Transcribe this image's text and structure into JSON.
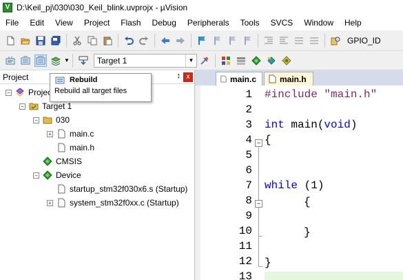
{
  "window": {
    "title": "D:\\Keil_pj\\030\\030_Keil_blink.uvprojx - µVision"
  },
  "menu": [
    "File",
    "Edit",
    "View",
    "Project",
    "Flash",
    "Debug",
    "Peripherals",
    "Tools",
    "SVCS",
    "Window",
    "Help"
  ],
  "toolbar": {
    "right_label": "GPIO_ID",
    "target_select": "Target 1"
  },
  "project_pane": {
    "title": "Project",
    "pin": "↕",
    "close": "x",
    "tree": {
      "root": "Project",
      "target": "Target 1",
      "group_030": "030",
      "file_main_c": "main.c",
      "file_main_h": "main.h",
      "cmsis": "CMSIS",
      "device": "Device",
      "startup": "startup_stm32f030x6.s (Startup)",
      "system": "system_stm32f0xx.c (Startup)"
    }
  },
  "tooltip": {
    "title": "Rebuild",
    "description": "Rebuild all target files"
  },
  "editor": {
    "tabs": [
      {
        "label": "main.c",
        "active": true
      },
      {
        "label": "main.h",
        "active": false
      }
    ],
    "line_numbers": [
      "1",
      "2",
      "3",
      "4",
      "5",
      "6",
      "7",
      "8",
      "9",
      "10",
      "11",
      "12",
      "13"
    ],
    "code": {
      "l1_directive": "#include",
      "l1_string": "\"main.h\"",
      "l3_keyword": "int",
      "l3_name": " main(",
      "l3_param": "void",
      "l3_close": ")",
      "l4": "{",
      "l7_keyword": "while",
      "l7_rest": " (1)",
      "l8": "{",
      "l10": "}",
      "l12": "}"
    }
  },
  "colors": {
    "keyword": "#0000ff",
    "preprocessor": "#7a2a6a",
    "active_tab": "#ffffff",
    "inactive_tab": "#fdf7d6",
    "close_button": "#c42b1c"
  }
}
